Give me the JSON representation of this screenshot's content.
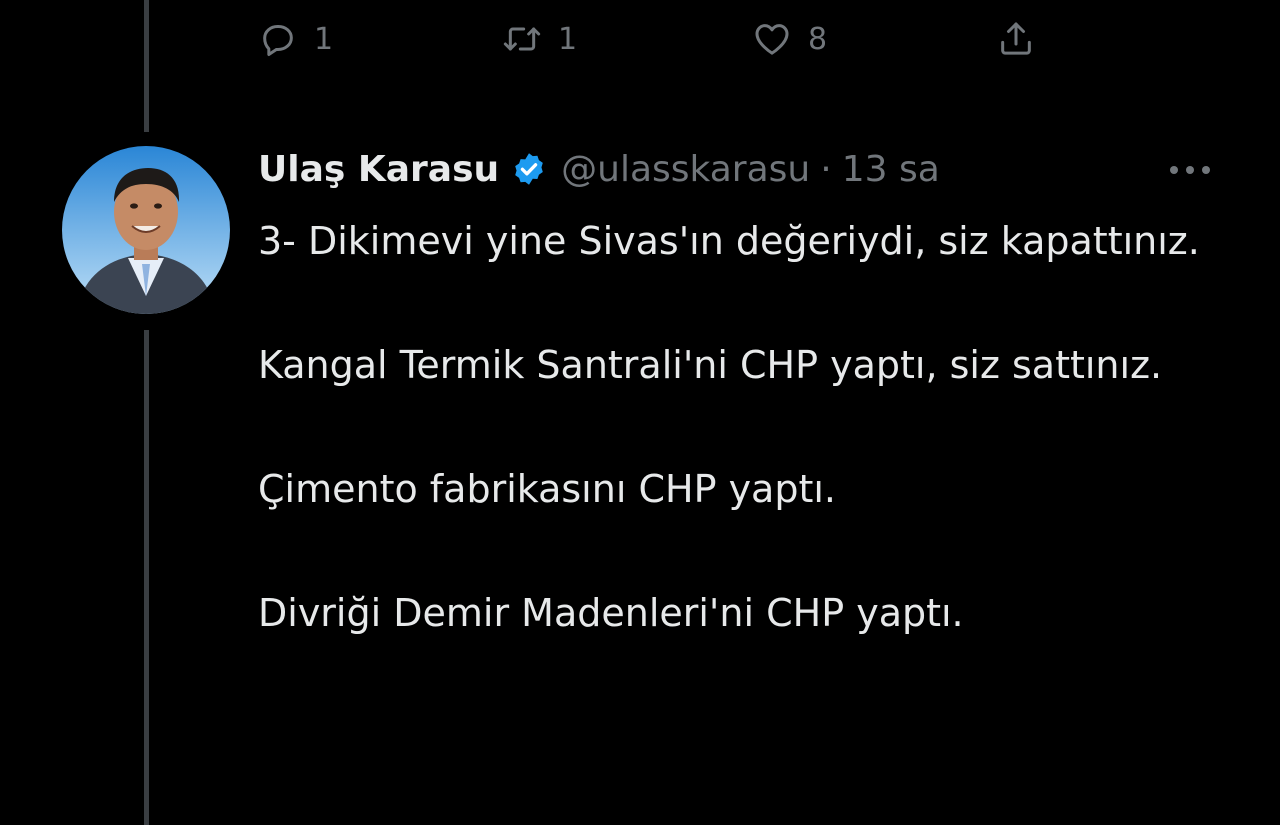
{
  "previous_tweet": {
    "actions": {
      "reply_count": "1",
      "retweet_count": "1",
      "like_count": "8"
    }
  },
  "tweet": {
    "author": {
      "display_name": "Ulaş Karasu",
      "handle": "@ulasskarasu",
      "verified": true,
      "avatar_icon": "profile-photo"
    },
    "separator": "·",
    "timestamp": "13 sa",
    "more_icon": "ellipsis-icon",
    "paragraphs": [
      "3- Dikimevi yine Sivas'ın değeriydi, siz kapattınız.",
      "Kangal Termik Santrali'ni CHP yaptı, siz sattınız.",
      "Çimento fabrikasını CHP yaptı.",
      "Divriği Demir Madenleri'ni CHP yaptı."
    ]
  },
  "colors": {
    "background": "#000000",
    "text_primary": "#e7e9ea",
    "text_secondary": "#71767b",
    "thread_line": "#3a3e42",
    "verified_badge": "#1d9bf0"
  }
}
